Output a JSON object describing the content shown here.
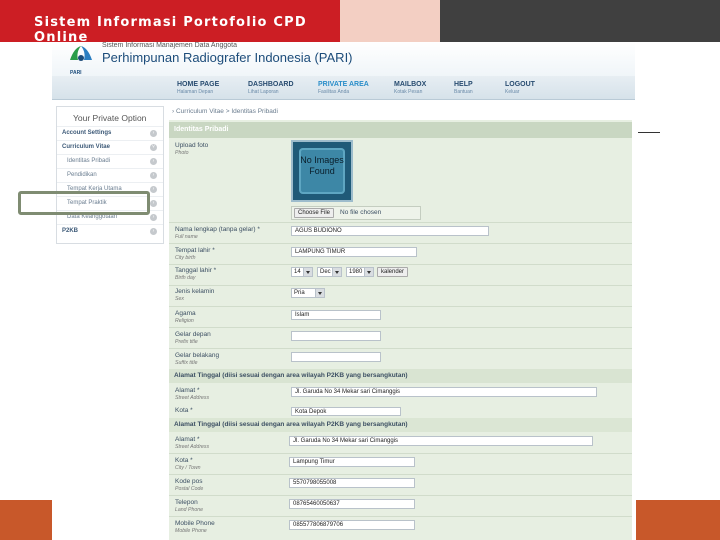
{
  "slide": {
    "title": "Sistem Informasi Portofolio CPD Online"
  },
  "site": {
    "subtitle": "Sistem Informasi Manajemen Data Anggota",
    "org_name": "Perhimpunan Radiografer Indonesia (PARI)",
    "logo_text": "PARI"
  },
  "nav": [
    {
      "label": "HOME PAGE",
      "sub": "Halaman Depan"
    },
    {
      "label": "DASHBOARD",
      "sub": "Lihat Laporan"
    },
    {
      "label": "PRIVATE AREA",
      "sub": "Fasilitas Anda"
    },
    {
      "label": "MAILBOX",
      "sub": "Kotak Pesan"
    },
    {
      "label": "HELP",
      "sub": "Bantuan"
    },
    {
      "label": "LOGOUT",
      "sub": "Keluar"
    }
  ],
  "sidebar": {
    "title": "Your Private Option",
    "items": [
      {
        "label": "Account Settings"
      },
      {
        "label": "Curriculum Vitae"
      },
      {
        "label": "Identitas Pribadi"
      },
      {
        "label": "Pendidikan"
      },
      {
        "label": "Tempat Kerja Utama"
      },
      {
        "label": "Tempat Praktik"
      },
      {
        "label": "Data Keanggotaan"
      },
      {
        "label": "P2KB"
      }
    ]
  },
  "breadcrumb": "Curriculum Vitae > Identitas Pribadi",
  "form": {
    "header": "Identitas Pribadi",
    "photo": {
      "label": "Upload foto",
      "sub": "Photo",
      "placeholder": "No Images Found",
      "button": "Choose File",
      "status": "No file chosen"
    },
    "full_name": {
      "label": "Nama lengkap (tanpa gelar) *",
      "sub": "Full name",
      "value": "AGUS BUDIONO"
    },
    "birth_place": {
      "label": "Tempat lahir *",
      "sub": "City birth",
      "value": "LAMPUNG TIMUR"
    },
    "birth_day": {
      "label": "Tanggal lahir *",
      "sub": "Birth day",
      "day": "14",
      "month": "Dec",
      "year": "1980",
      "calendar": "kalender"
    },
    "sex": {
      "label": "Jenis kelamin",
      "sub": "Sex",
      "value": "Pria"
    },
    "religion": {
      "label": "Agama",
      "sub": "Religion",
      "value": "Islam"
    },
    "prefix": {
      "label": "Gelar depan",
      "sub": "Prefix title",
      "value": ""
    },
    "suffix": {
      "label": "Gelar belakang",
      "sub": "Suffix title",
      "value": ""
    },
    "address_section": "Alamat Tinggal (diisi sesuai dengan area wilayah P2KB yang bersangkutan)",
    "address": {
      "label": "Alamat *",
      "sub": "Street Address",
      "value": "Jl. Garuda No 34 Mekar sari Cimanggis"
    },
    "city": {
      "label": "Kota *",
      "value": "Kota Depok"
    }
  },
  "form2": {
    "address_section": "Alamat Tinggal (diisi sesuai dengan area wilayah P2KB yang bersangkutan)",
    "address": {
      "label": "Alamat *",
      "sub": "Street Address",
      "value": "Jl. Garuda No 34 Mekar sari Cimanggis"
    },
    "city": {
      "label": "Kota *",
      "sub": "City / Town",
      "value": "Lampung Timur"
    },
    "postal": {
      "label": "Kode pos",
      "sub": "Postal Code",
      "value": "5570798055008"
    },
    "phone": {
      "label": "Telepon",
      "sub": "Land Phone",
      "value": "08765460050637"
    },
    "mobile": {
      "label": "Mobile Phone",
      "sub": "Mobile Phone",
      "value": "085577806879706"
    }
  },
  "colors": {
    "title_red": "#cc1e24",
    "accent_blue": "#1c4c7a",
    "footer_orange": "#c8582a"
  }
}
